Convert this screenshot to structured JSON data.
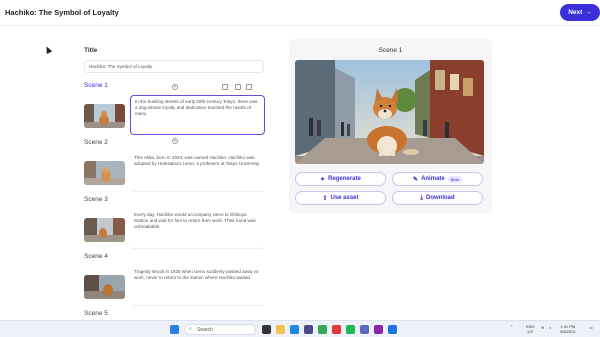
{
  "header": {
    "title": "Hachiko: The Symbol of Loyalty",
    "next_label": "Next",
    "next_icon": "arrow-right-icon"
  },
  "form": {
    "title_label": "Title",
    "title_value": "Hachiko: The Symbol of Loyalty"
  },
  "scenes": [
    {
      "label": "Scene 1",
      "text": "In the bustling streets of early 20th-century Tokyo, there was a dog whose loyalty and dedication touched the hearts of many."
    },
    {
      "label": "Scene 2",
      "text": "This Akita, born in 1923, was named Hachiko. Hachiko was adopted by Hidesaburo Ueno, a professor at Tokyo University."
    },
    {
      "label": "Scene 3",
      "text": "Every day, Hachiko would accompany Ueno to Shibuya Station and wait for him to return from work. Their bond was unbreakable."
    },
    {
      "label": "Scene 4",
      "text": "Tragedy struck in 1925 when Ueno suddenly passed away at work, never to return to the station where Hachiko waited."
    },
    {
      "label": "Scene 5",
      "text": ""
    }
  ],
  "preview": {
    "heading": "Scene 1",
    "regenerate_label": "Regenerate",
    "animate_label": "Animate",
    "animate_badge": "Beta",
    "use_asset_label": "Use asset",
    "download_label": "Download"
  },
  "taskbar": {
    "search_placeholder": "Search",
    "lang_line1": "ENG",
    "lang_line2": "US",
    "time": "1:41 PM",
    "date": "9/8/2024"
  },
  "colors": {
    "accent": "#3b2fd9",
    "panel": "#f6f6f8"
  }
}
